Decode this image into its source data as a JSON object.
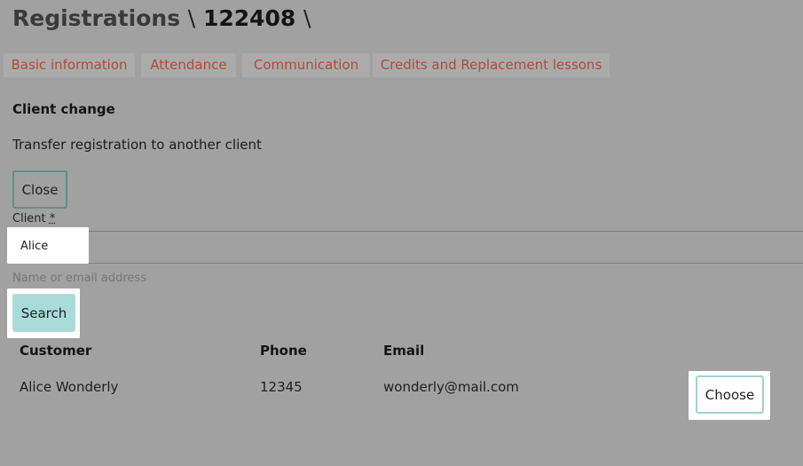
{
  "header": {
    "crumb": "Registrations",
    "separator": "\\",
    "registration_id": "122408",
    "trailing_separator": "\\"
  },
  "tabs": [
    {
      "label": "Basic information"
    },
    {
      "label": "Attendance"
    },
    {
      "label": "Communication"
    },
    {
      "label": "Credits and Replacement lessons"
    }
  ],
  "client_change": {
    "title": "Client change",
    "description": "Transfer registration to another client",
    "close_label": "Close",
    "field_label": "Client",
    "required_mark": "*",
    "input_value": "Alice",
    "hint": "Name or email address",
    "search_label": "Search"
  },
  "results": {
    "headers": {
      "customer": "Customer",
      "phone": "Phone",
      "email": "Email"
    },
    "rows": [
      {
        "customer": "Alice Wonderly",
        "phone": "12345",
        "email": "wonderly@mail.com",
        "action": "Choose"
      }
    ]
  },
  "colors": {
    "backdrop": "#a1a1a1",
    "tab_text": "#b24a32",
    "search_button": "#a9dcd9",
    "close_border": "#5f8f86",
    "choose_border": "#9fd1cd"
  }
}
